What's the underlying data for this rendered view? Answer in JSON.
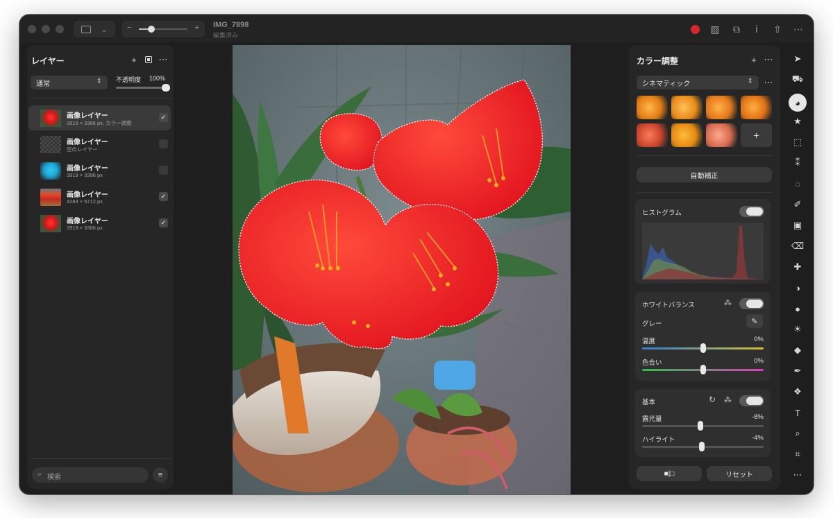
{
  "title_bar": {
    "doc_title": "IMG_7898",
    "doc_subtitle": "編集済み",
    "zoom_minus": "−",
    "zoom_plus": "+",
    "zoom_level": 0.25
  },
  "layers_panel": {
    "title": "レイヤー",
    "add_label": "+",
    "more_label": "⋯",
    "blend_mode": "通常",
    "opacity_label": "不透明度",
    "opacity_value": "100%",
    "layers": [
      {
        "name": "画像レイヤー",
        "info": "3919 × 3386 px, カラー調整",
        "visible": true,
        "selected": true,
        "thumb": "flower-red"
      },
      {
        "name": "画像レイヤー",
        "info": "空のレイヤー",
        "visible": false,
        "selected": false,
        "thumb": "empty"
      },
      {
        "name": "画像レイヤー",
        "info": "3919 × 3386 px",
        "visible": false,
        "selected": false,
        "thumb": "flower-cyan"
      },
      {
        "name": "画像レイヤー",
        "info": "4284 × 5712 px",
        "visible": true,
        "selected": false,
        "thumb": "photo"
      },
      {
        "name": "画像レイヤー",
        "info": "3919 × 3386 px",
        "visible": true,
        "selected": false,
        "thumb": "flower-red"
      }
    ],
    "search_placeholder": "検索"
  },
  "color_panel": {
    "title": "カラー調整",
    "add_label": "+",
    "more_label": "⋯",
    "preset": "シネマティック",
    "auto_label": "自動補正",
    "histogram_label": "ヒストグラム",
    "white_balance": {
      "label": "ホワイトバランス",
      "gray_label": "グレー",
      "temp_label": "温度",
      "temp_value": "0%",
      "tint_label": "色合い",
      "tint_value": "0%"
    },
    "basic": {
      "label": "基本",
      "exposure_label": "露光量",
      "exposure_value": "-8%",
      "highlight_label": "ハイライト",
      "highlight_value": "-4%"
    },
    "compare_label": "■|□",
    "reset_label": "リセット"
  },
  "colors": {
    "accent_red": "#d9262a",
    "panel": "#262626",
    "window": "#1e1e1e"
  }
}
